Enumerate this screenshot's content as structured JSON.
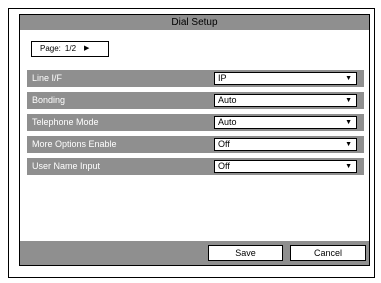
{
  "window": {
    "title": "Dial Setup"
  },
  "page_selector": {
    "label": "Page:",
    "value": "1/2",
    "next_icon": "triangle-right-icon"
  },
  "settings": [
    {
      "label": "Line I/F",
      "value": "IP"
    },
    {
      "label": "Bonding",
      "value": "Auto"
    },
    {
      "label": "Telephone Mode",
      "value": "Auto"
    },
    {
      "label": "More Options Enable",
      "value": "Off"
    },
    {
      "label": "User Name Input",
      "value": "Off"
    }
  ],
  "footer": {
    "save_label": "Save",
    "cancel_label": "Cancel"
  },
  "colors": {
    "bar_gray": "#8f8f8f"
  }
}
